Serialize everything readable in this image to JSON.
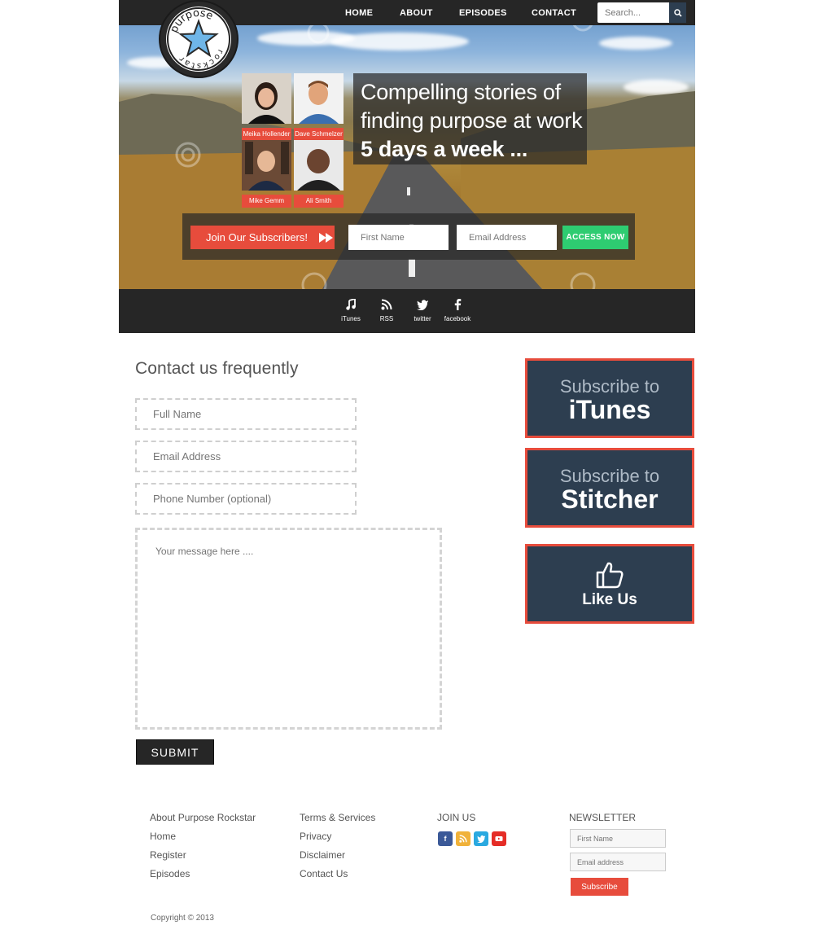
{
  "nav": {
    "items": [
      "HOME",
      "ABOUT",
      "EPISODES",
      "CONTACT"
    ],
    "search_placeholder": "Search..."
  },
  "hero": {
    "hosts": [
      {
        "name": "Meika Hollender"
      },
      {
        "name": "Dave Schmelzer"
      },
      {
        "name": "Mike Gemm"
      },
      {
        "name": "Ali Smith"
      }
    ],
    "headline": [
      "Compelling stories of",
      "finding purpose at work",
      "5 days a week ..."
    ],
    "optin": {
      "join_label": "Join Our Subscribers!",
      "first_name_placeholder": "First Name",
      "email_placeholder": "Email Address",
      "access_label": "ACCESS NOW"
    }
  },
  "social": [
    {
      "label": "iTunes",
      "icon": "music-note-icon"
    },
    {
      "label": "RSS",
      "icon": "rss-icon"
    },
    {
      "label": "twitter",
      "icon": "twitter-icon"
    },
    {
      "label": "facebook",
      "icon": "facebook-icon"
    }
  ],
  "contact": {
    "title": "Contact us frequently",
    "full_name_placeholder": "Full Name",
    "email_placeholder": "Email Address",
    "phone_placeholder": "Phone Number (optional)",
    "message_placeholder": "Your message here ....",
    "submit_label": "SUBMIT"
  },
  "sidebar": {
    "itunes": {
      "line1": "Subscribe to",
      "line2": "iTunes"
    },
    "stitcher": {
      "line1": "Subscribe to",
      "line2": "Stitcher"
    },
    "like": {
      "label": "Like Us",
      "icon": "thumbs-up-icon"
    }
  },
  "footer": {
    "col1": [
      "About Purpose Rockstar",
      "Home",
      "Register",
      "Episodes"
    ],
    "col2": [
      "Terms & Services",
      "Privacy",
      "Disclaimer",
      "Contact Us"
    ],
    "join_title": "JOIN US",
    "join_icons": [
      {
        "name": "facebook-icon",
        "glyph": "f",
        "color": "#3b5998"
      },
      {
        "name": "rss-icon",
        "glyph": "◠",
        "color": "#f0b23a"
      },
      {
        "name": "twitter-icon",
        "glyph": "t",
        "color": "#2aa9e0"
      },
      {
        "name": "youtube-icon",
        "glyph": "▶",
        "color": "#e52d27"
      }
    ],
    "newsletter_title": "NEWSLETTER",
    "newsletter_first_placeholder": "First Name",
    "newsletter_email_placeholder": "Email address",
    "newsletter_button": "Subscribe",
    "copyright": "Copyright © 2013"
  },
  "colors": {
    "accent_red": "#e74c3c",
    "navy": "#2d3e50",
    "green": "#2ecc71",
    "dark_bar": "#262626"
  },
  "logo": {
    "text_top": "purpose",
    "text_bottom": "rockstar"
  }
}
